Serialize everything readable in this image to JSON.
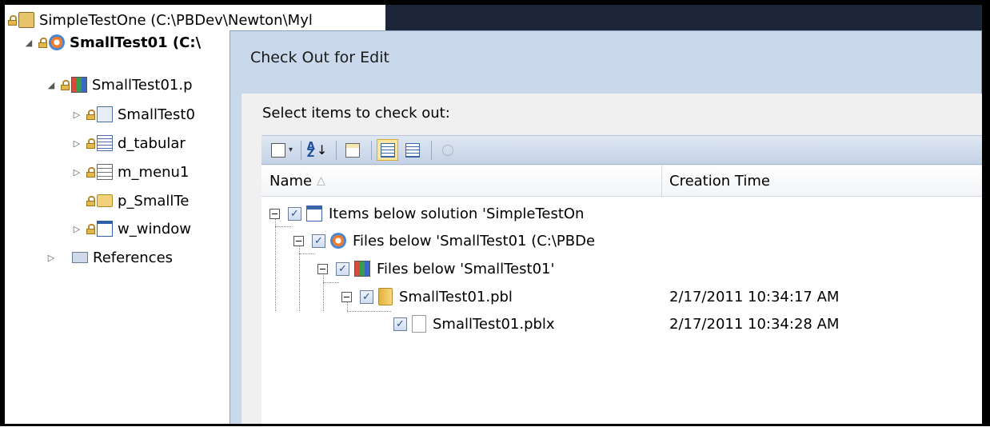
{
  "explorer": {
    "nodes": [
      {
        "label": "SimpleTestOne (C:\\PBDev\\Newton\\Myl",
        "icon": "workspace-icon"
      },
      {
        "label": "SmallTest01 (C:\\",
        "icon": "target-icon"
      },
      {
        "label": "SmallTest01.p",
        "icon": "library-icon"
      },
      {
        "label": "SmallTest0",
        "icon": "application-icon"
      },
      {
        "label": "d_tabular",
        "icon": "datawindow-icon"
      },
      {
        "label": "m_menu1",
        "icon": "menu-icon"
      },
      {
        "label": "p_SmallTe",
        "icon": "project-icon"
      },
      {
        "label": "w_window",
        "icon": "window-icon"
      },
      {
        "label": "References",
        "icon": "references-icon"
      }
    ]
  },
  "dialog": {
    "title": "Check Out for Edit",
    "prompt": "Select items to check out:",
    "columns": {
      "name": "Name",
      "sort_glyph": "△",
      "creation_time": "Creation Time"
    },
    "rows": [
      {
        "name": "Items below solution 'SimpleTestOn",
        "time": "",
        "checked": "✓",
        "icon": "solution-icon"
      },
      {
        "name": "Files below 'SmallTest01 (C:\\PBDe",
        "time": "",
        "checked": "✓",
        "icon": "target-icon"
      },
      {
        "name": "Files below 'SmallTest01'",
        "time": "",
        "checked": "✓",
        "icon": "library-icon"
      },
      {
        "name": "SmallTest01.pbl",
        "time": "2/17/2011 10:34:17 AM",
        "checked": "✓",
        "icon": "folder-icon"
      },
      {
        "name": "SmallTest01.pblx",
        "time": "2/17/2011 10:34:28 AM",
        "checked": "✓",
        "icon": "file-icon"
      }
    ]
  },
  "toolbar": {
    "sort_top": "A",
    "sort_bottom": "Z",
    "dropdown_glyph": "▾"
  },
  "colors": {
    "dialog_frame": "#c9d8ea",
    "title_bar": "#1c2638",
    "toolbar": "#c4d2e6",
    "selected_button": "#fbe7a0"
  }
}
